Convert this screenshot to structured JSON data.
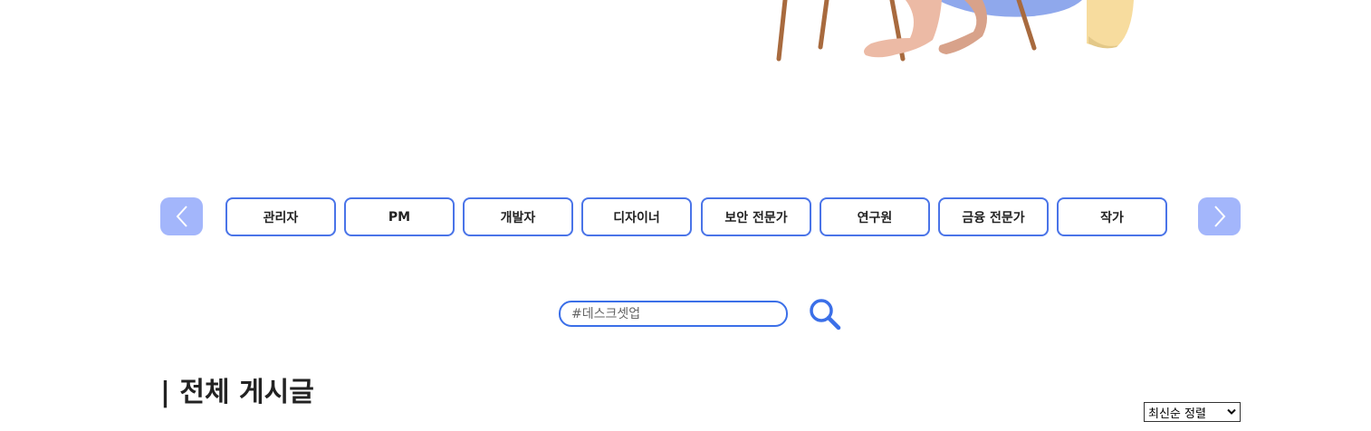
{
  "categories": [
    "관리자",
    "PM",
    "개발자",
    "디자이너",
    "보안 전문가",
    "연구원",
    "금융 전문가",
    "작가"
  ],
  "search": {
    "placeholder": "#데스크셋업"
  },
  "section": {
    "title": "| 전체 게시글"
  },
  "sort": {
    "selected": "최신순 정렬"
  },
  "colors": {
    "accent": "#4a74e8",
    "arrow_bg": "#a3b6fb",
    "search_icon": "#3b6fe8"
  },
  "icons": {
    "prev": "chevron-left-icon",
    "next": "chevron-right-icon",
    "search": "magnifier-icon",
    "sort": "chevron-down-icon"
  }
}
